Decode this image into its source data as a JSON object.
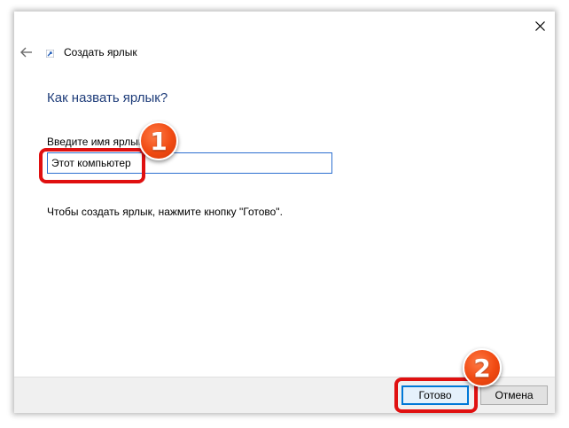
{
  "dialog": {
    "title": "Создать ярлык",
    "heading": "Как назвать ярлык?",
    "field_label": "Введите имя ярлыка:",
    "name_value": "Этот компьютер",
    "hint": "Чтобы создать ярлык, нажмите кнопку \"Готово\".",
    "buttons": {
      "ok_label": "Готово",
      "cancel_label": "Отмена"
    }
  },
  "annotations": {
    "badge_1": "1",
    "badge_2": "2",
    "highlight_color": "#e01010",
    "badge_color": "#f04a12"
  },
  "icons": {
    "close": "close-icon",
    "back": "back-arrow-icon",
    "title": "shortcut-icon"
  }
}
